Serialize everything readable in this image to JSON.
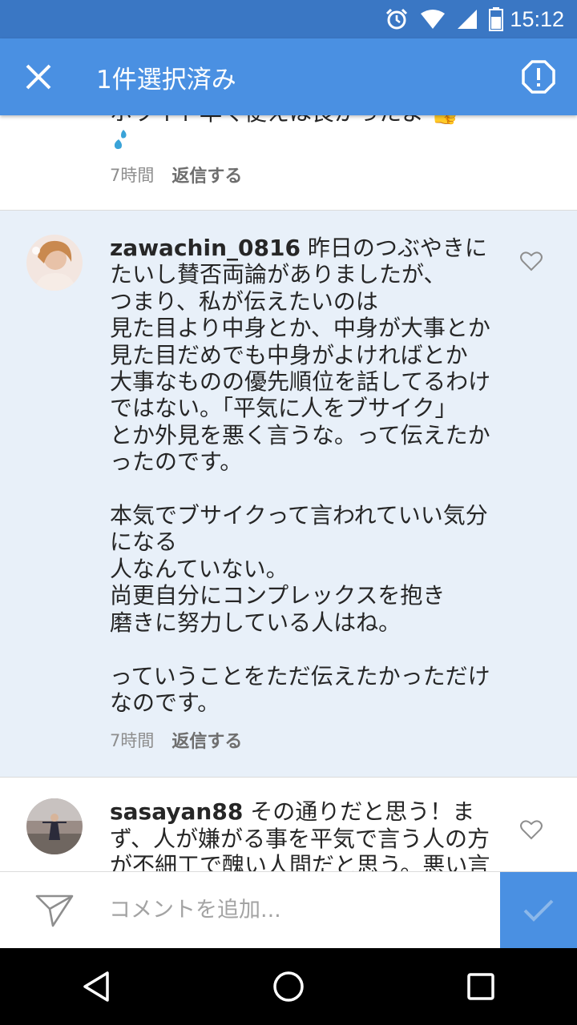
{
  "status_bar": {
    "time": "15:12",
    "icons": [
      "alarm-icon",
      "wifi-icon",
      "signal-icon",
      "battery-icon"
    ]
  },
  "action_bar": {
    "title": "1件選択済み",
    "close_icon": "close-icon",
    "report_icon": "report-icon"
  },
  "comments": [
    {
      "partial_text": "ホワイト早く便えは良かったよ 👍",
      "time": "7時間",
      "reply_label": "返信する"
    },
    {
      "username": "zawachin_0816",
      "text": " 昨日のつぶやきにたいし賛否両論がありましたが、\nつまり、私が伝えたいのは\n見た目より中身とか、中身が大事とか\n見た目だめでも中身がよければとか\n大事なものの優先順位を話してるわけではない。「平気に人をブサイク」\nとか外見を悪く言うな。って伝えたかったのです。\n\n本気でブサイクって言われていい気分になる\n人なんていない。\n尚更自分にコンプレックスを抱き\n磨きに努力している人はね。\n\nっていうことをただ伝えたかっただけなのです。",
      "time": "7時間",
      "reply_label": "返信する",
      "selected": true
    },
    {
      "username": "sasayan88",
      "text": " その通りだと思う！まず、人が嫌がる事を平気で言う人の方が不細工で醜い人間だと思う。悪い言葉ば"
    }
  ],
  "composer": {
    "placeholder": "コメントを追加..."
  },
  "colors": {
    "accent": "#4a90e2",
    "status_bar": "#3a77c4",
    "selected_bg": "#e8f0f9"
  }
}
